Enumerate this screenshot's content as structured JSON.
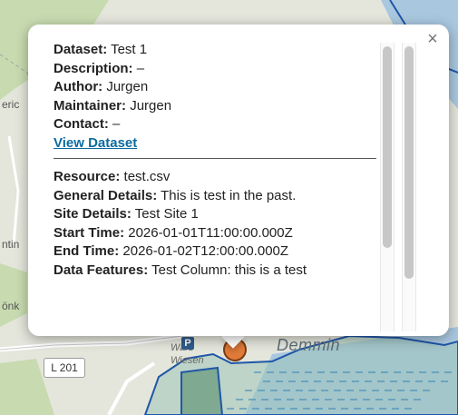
{
  "map": {
    "labels": {
      "demmin": "Demmin",
      "wars_line1": "Wars",
      "wars_line2": "Wiesen",
      "road": "L 201",
      "edge_eric": "eric",
      "edge_ntin": "ntin",
      "edge_onk": "önk",
      "parking": "P"
    },
    "colors": {
      "land": "#e4e6dc",
      "forest": "#c8dbb0",
      "water": "#a9c7df",
      "protected_fill": "#7fa990",
      "protected_border": "#1f56a8",
      "marker": "#e07a3a"
    }
  },
  "popup": {
    "close_label": "×",
    "dataset": {
      "dataset_label": "Dataset:",
      "dataset_value": "Test 1",
      "description_label": "Description:",
      "description_value": "–",
      "author_label": "Author:",
      "author_value": "Jurgen",
      "maintainer_label": "Maintainer:",
      "maintainer_value": "Jurgen",
      "contact_label": "Contact:",
      "contact_value": "–",
      "view_link": "View Dataset"
    },
    "resource": {
      "resource_label": "Resource:",
      "resource_value": "test.csv",
      "general_label": "General Details:",
      "general_value": "This is test in the past.",
      "site_label": "Site Details:",
      "site_value": "Test Site 1",
      "start_label": "Start Time:",
      "start_value": "2026-01-01T11:00:00.000Z",
      "end_label": "End Time:",
      "end_value": "2026-01-02T12:00:00.000Z",
      "features_label": "Data Features:",
      "features_value": "Test Column: this is a test"
    }
  }
}
